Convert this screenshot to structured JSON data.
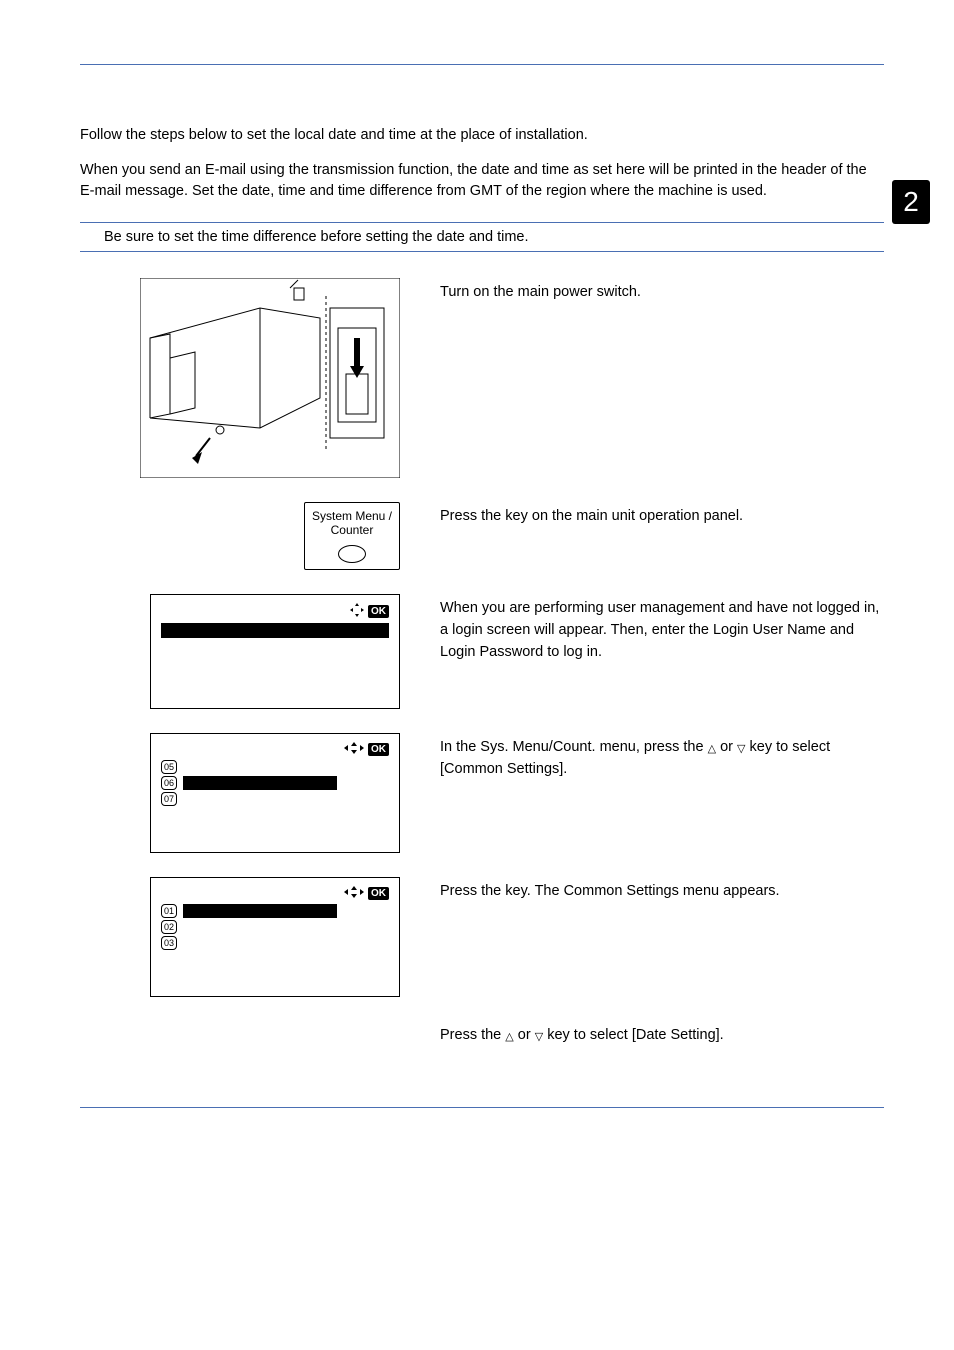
{
  "tab_number": "2",
  "intro1": "Follow the steps below to set the local date and time at the place of installation.",
  "intro2": "When you send an E-mail using the transmission function, the date and time as set here will be printed in the header of the E-mail message. Set the date, time and time difference from GMT of the region where the machine is used.",
  "note": "Be sure to set the time difference before setting the date and time.",
  "step1": "Turn on the main power switch.",
  "step2a": "Press the ",
  "step2b": " key on the main unit operation panel.",
  "btn_line1": "System Menu /",
  "btn_line2": "Counter",
  "step3": "When you are performing user management and have not logged in, a login screen will appear. Then, enter the Login User Name and Login Password to log in.",
  "step4a": "In the Sys. Menu/Count. menu, press the ",
  "step4b": " or ",
  "step4c": " key to select [Common Settings].",
  "step5a": "Press the ",
  "step5b": " key. The Common Settings menu appears.",
  "step6a": "Press the ",
  "step6b": " or ",
  "step6c": " key to select [Date Setting].",
  "ok_label": "OK",
  "menu1": {
    "items": [
      {
        "num": "05",
        "label": ""
      },
      {
        "num": "06",
        "label": ""
      },
      {
        "num": "07",
        "label": ""
      }
    ]
  },
  "menu2": {
    "items": [
      {
        "num": "01",
        "label": ""
      },
      {
        "num": "02",
        "label": ""
      },
      {
        "num": "03",
        "label": ""
      }
    ]
  }
}
